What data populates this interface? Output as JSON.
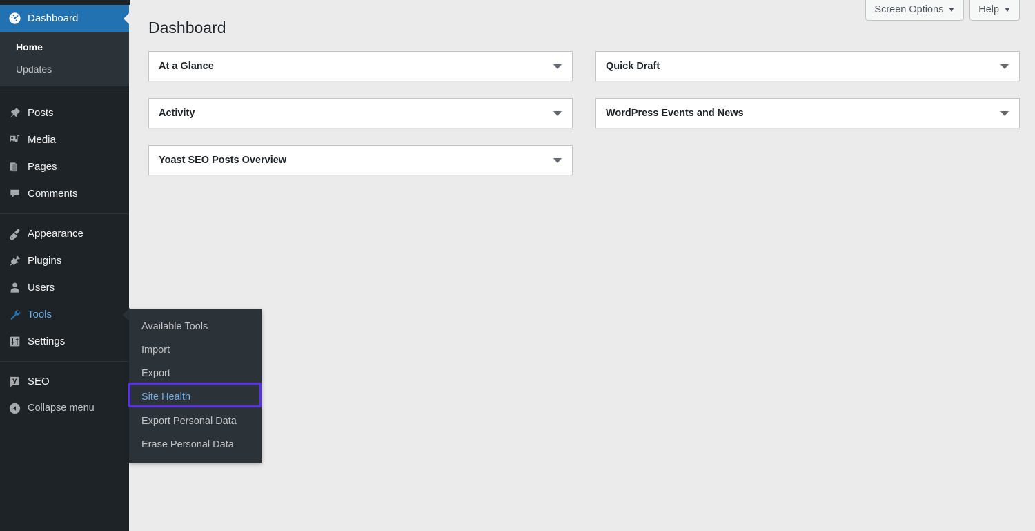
{
  "sidebar": {
    "items": [
      {
        "label": "Dashboard",
        "icon": "dashboard-icon",
        "state": "current"
      },
      {
        "label": "Posts",
        "icon": "pin-icon",
        "state": "normal"
      },
      {
        "label": "Media",
        "icon": "media-icon",
        "state": "normal"
      },
      {
        "label": "Pages",
        "icon": "pages-icon",
        "state": "normal"
      },
      {
        "label": "Comments",
        "icon": "comments-icon",
        "state": "normal"
      },
      {
        "label": "Appearance",
        "icon": "brush-icon",
        "state": "normal"
      },
      {
        "label": "Plugins",
        "icon": "plug-icon",
        "state": "normal"
      },
      {
        "label": "Users",
        "icon": "user-icon",
        "state": "normal"
      },
      {
        "label": "Tools",
        "icon": "wrench-icon",
        "state": "open"
      },
      {
        "label": "Settings",
        "icon": "settings-icon",
        "state": "normal"
      },
      {
        "label": "SEO",
        "icon": "yoast-icon",
        "state": "normal"
      }
    ],
    "dashboard_submenu": [
      {
        "label": "Home",
        "state": "current"
      },
      {
        "label": "Updates",
        "state": "normal"
      }
    ],
    "collapse": {
      "label": "Collapse menu",
      "icon": "collapse-arrow-icon"
    }
  },
  "flyout": {
    "parent": "Tools",
    "items": [
      {
        "label": "Available Tools",
        "state": "normal"
      },
      {
        "label": "Import",
        "state": "normal"
      },
      {
        "label": "Export",
        "state": "normal"
      },
      {
        "label": "Site Health",
        "state": "highlighted"
      },
      {
        "label": "Export Personal Data",
        "state": "normal"
      },
      {
        "label": "Erase Personal Data",
        "state": "normal"
      }
    ],
    "highlight_color": "#5b2ff0"
  },
  "header": {
    "page_title": "Dashboard",
    "screen_options_label": "Screen Options",
    "help_label": "Help",
    "caret_glyph": "▼"
  },
  "main": {
    "left_column": [
      {
        "title": "At a Glance",
        "collapsed": true
      },
      {
        "title": "Activity",
        "collapsed": true
      },
      {
        "title": "Yoast SEO Posts Overview",
        "collapsed": true
      }
    ],
    "right_column": [
      {
        "title": "Quick Draft",
        "collapsed": true
      },
      {
        "title": "WordPress Events and News",
        "collapsed": true
      }
    ]
  },
  "theme": {
    "sidebar_bg": "#1d2327",
    "submenu_bg": "#2c3338",
    "accent_blue": "#2271b1",
    "link_blue": "#72aee6",
    "content_bg": "#ebebeb",
    "box_border": "#c3c4c7"
  }
}
